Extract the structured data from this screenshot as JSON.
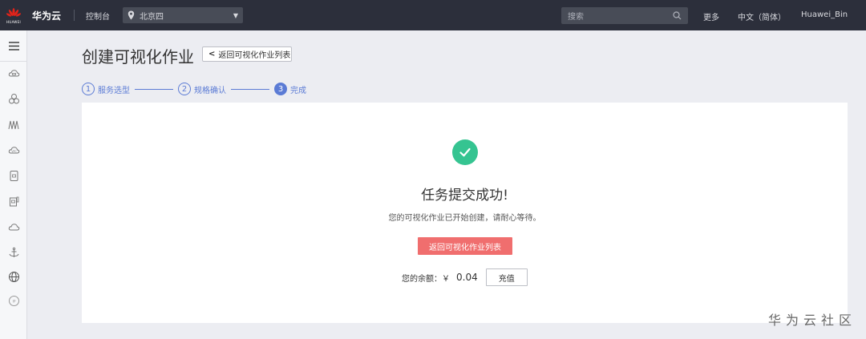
{
  "topbar": {
    "logo_text": "HUAWEI",
    "brand": "华为云",
    "console": "控制台",
    "region": "北京四",
    "search_placeholder": "搜索",
    "more": "更多",
    "language": "中文（简体）",
    "user": "Huawei_Bin"
  },
  "sidebar": {
    "icons": [
      "menu-icon",
      "cloud-server-icon",
      "cluster-icon",
      "waveform-icon",
      "vpc-icon",
      "storage-icon",
      "database-icon",
      "cloud-icon",
      "anchor-icon",
      "globe-icon",
      "ip-icon"
    ]
  },
  "main": {
    "title": "创建可视化作业",
    "back_button": "返回可视化作业列表",
    "steps": [
      {
        "num": "1",
        "label": "服务选型"
      },
      {
        "num": "2",
        "label": "规格确认"
      },
      {
        "num": "3",
        "label": "完成"
      }
    ],
    "success_title": "任务提交成功!",
    "success_desc": "您的可视化作业已开始创建，请耐心等待。",
    "primary_button": "返回可视化作业列表",
    "balance_label": "您的余额：￥",
    "balance_amount": "0.04",
    "recharge_button": "充值"
  },
  "watermark": "华为云社区",
  "colors": {
    "topbar_bg": "#2c2f3b",
    "accent_blue": "#5b7bd5",
    "success_green": "#35c491",
    "primary_red": "#f06e6e",
    "logo_red": "#e2231a"
  }
}
